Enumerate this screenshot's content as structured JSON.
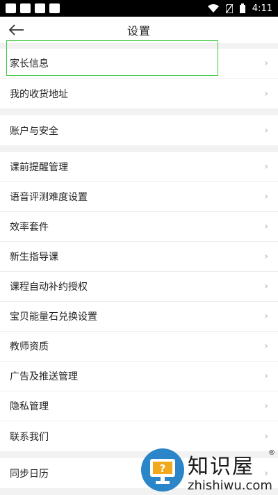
{
  "status_bar": {
    "time": "4:11"
  },
  "header": {
    "title": "设置"
  },
  "sections": [
    {
      "items": [
        "家长信息",
        "我的收货地址"
      ]
    },
    {
      "items": [
        "账户与安全"
      ]
    },
    {
      "items": [
        "课前提醒管理",
        "语音评测难度设置",
        "效率套件",
        "新生指导课",
        "课程自动补约授权",
        "宝贝能量石兑换设置",
        "教师资质",
        "广告及推送管理",
        "隐私管理",
        "联系我们"
      ]
    },
    {
      "items": [
        "同步日历"
      ]
    }
  ],
  "chevron": "›",
  "highlight_color": "#3ec83e",
  "watermark": {
    "title": "知识屋",
    "reg": "®",
    "url": "zhishiwu.com",
    "logo_color": "#2a86c8"
  }
}
